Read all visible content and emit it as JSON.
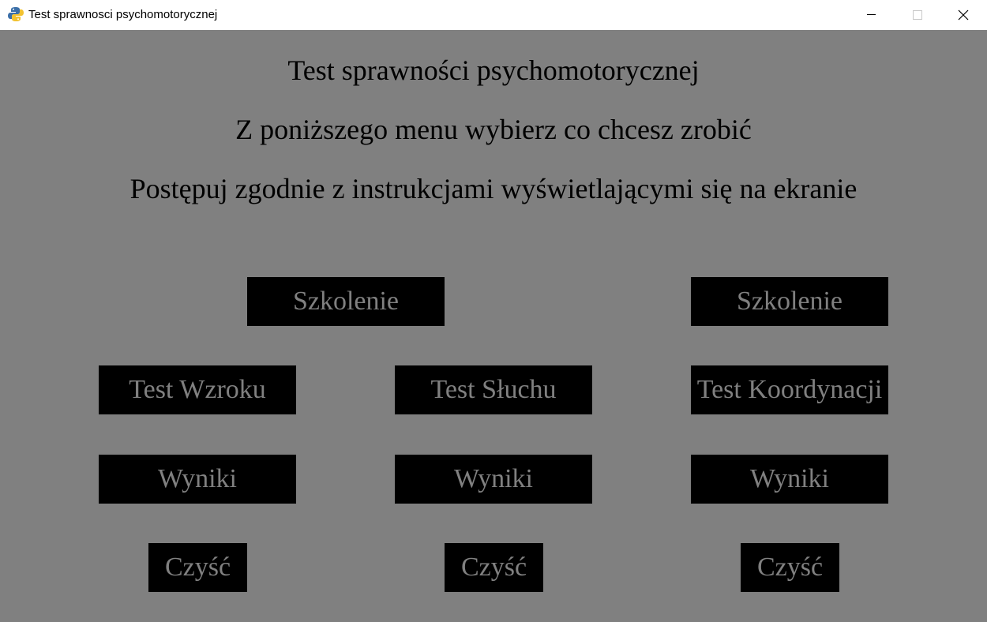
{
  "window": {
    "title": "Test sprawnosci psychomotorycznej",
    "icon": "python-icon"
  },
  "content": {
    "background": "#808080",
    "headings": [
      "Test sprawności psychomotorycznej",
      "Z poniższego menu wybierz co chcesz zrobić",
      "Postępuj zgodnie z instrukcjami wyświetlającymi się na ekranie"
    ],
    "buttons": {
      "training_left": "Szkolenie",
      "training_right": "Szkolenie",
      "test_vision": "Test Wzroku",
      "test_hearing": "Test Słuchu",
      "test_coordination": "Test Koordynacji",
      "results_vision": "Wyniki",
      "results_hearing": "Wyniki",
      "results_coordination": "Wyniki",
      "clear_vision": "Czyść",
      "clear_hearing": "Czyść",
      "clear_coordination": "Czyść"
    },
    "button_colors": {
      "fill": "#000000",
      "text": "#808080"
    }
  }
}
